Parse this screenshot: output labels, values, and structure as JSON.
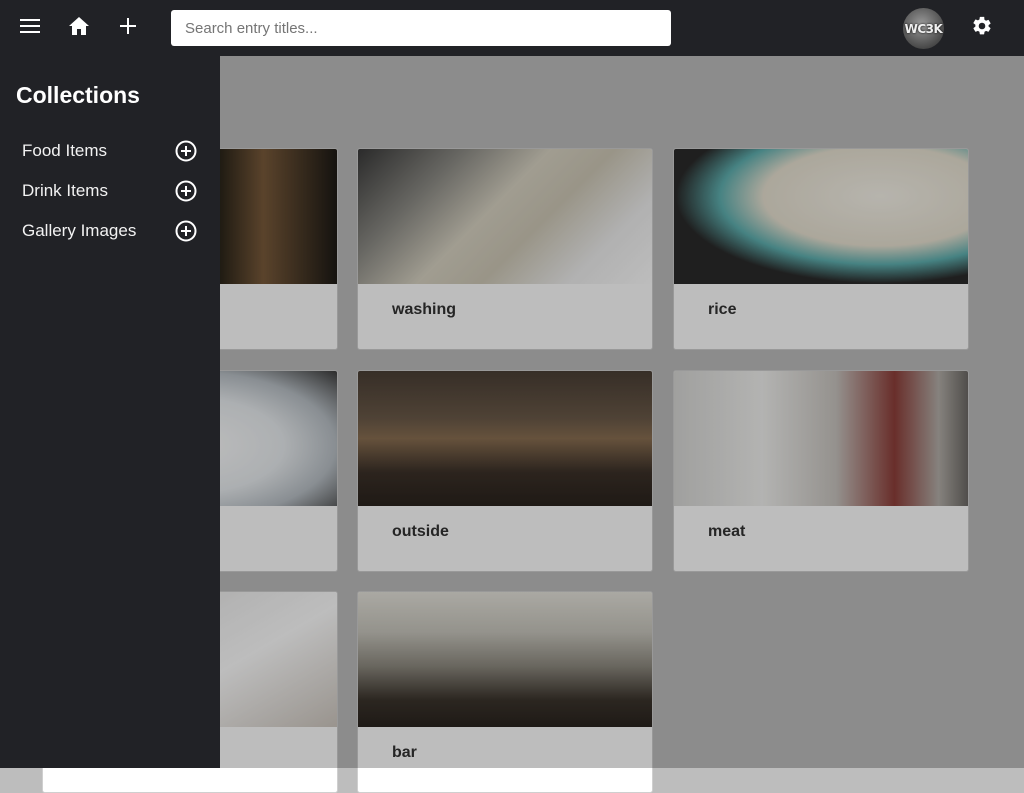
{
  "search": {
    "placeholder": "Search entry titles..."
  },
  "user": {
    "avatar_text": "WC3K"
  },
  "drawer": {
    "heading": "Collections",
    "items": [
      {
        "label": "Food Items"
      },
      {
        "label": "Drink Items"
      },
      {
        "label": "Gallery Images"
      }
    ]
  },
  "cards": [
    {
      "title": ""
    },
    {
      "title": "washing"
    },
    {
      "title": "rice"
    },
    {
      "title": ""
    },
    {
      "title": "outside"
    },
    {
      "title": "meat"
    },
    {
      "title": ""
    },
    {
      "title": "bar"
    }
  ],
  "icons": {
    "menu": "menu-icon",
    "home": "home-icon",
    "add": "plus-icon",
    "settings": "gear-icon",
    "collection_add": "add-circle-icon"
  },
  "colors": {
    "bar": "#212226",
    "drawer": "#212226",
    "card": "#ffffff"
  }
}
